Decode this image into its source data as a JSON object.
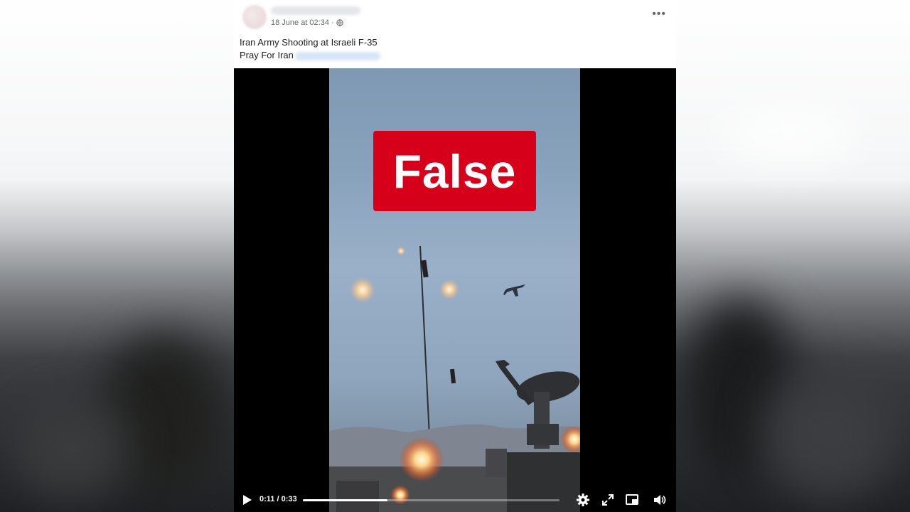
{
  "post": {
    "timestamp": "18 June at 02:34",
    "text_line_1": "Iran Army Shooting at Israeli F-35",
    "text_line_2": "Pray For Iran",
    "more_icon": "more-options-icon"
  },
  "video": {
    "overlay_label": "False",
    "overlay_color": "#d6001a",
    "time": "0:11 / 0:33",
    "progress": 0.33,
    "icons": [
      "play-icon",
      "settings-icon",
      "fullscreen-icon",
      "picture-in-picture-icon",
      "volume-icon"
    ]
  }
}
